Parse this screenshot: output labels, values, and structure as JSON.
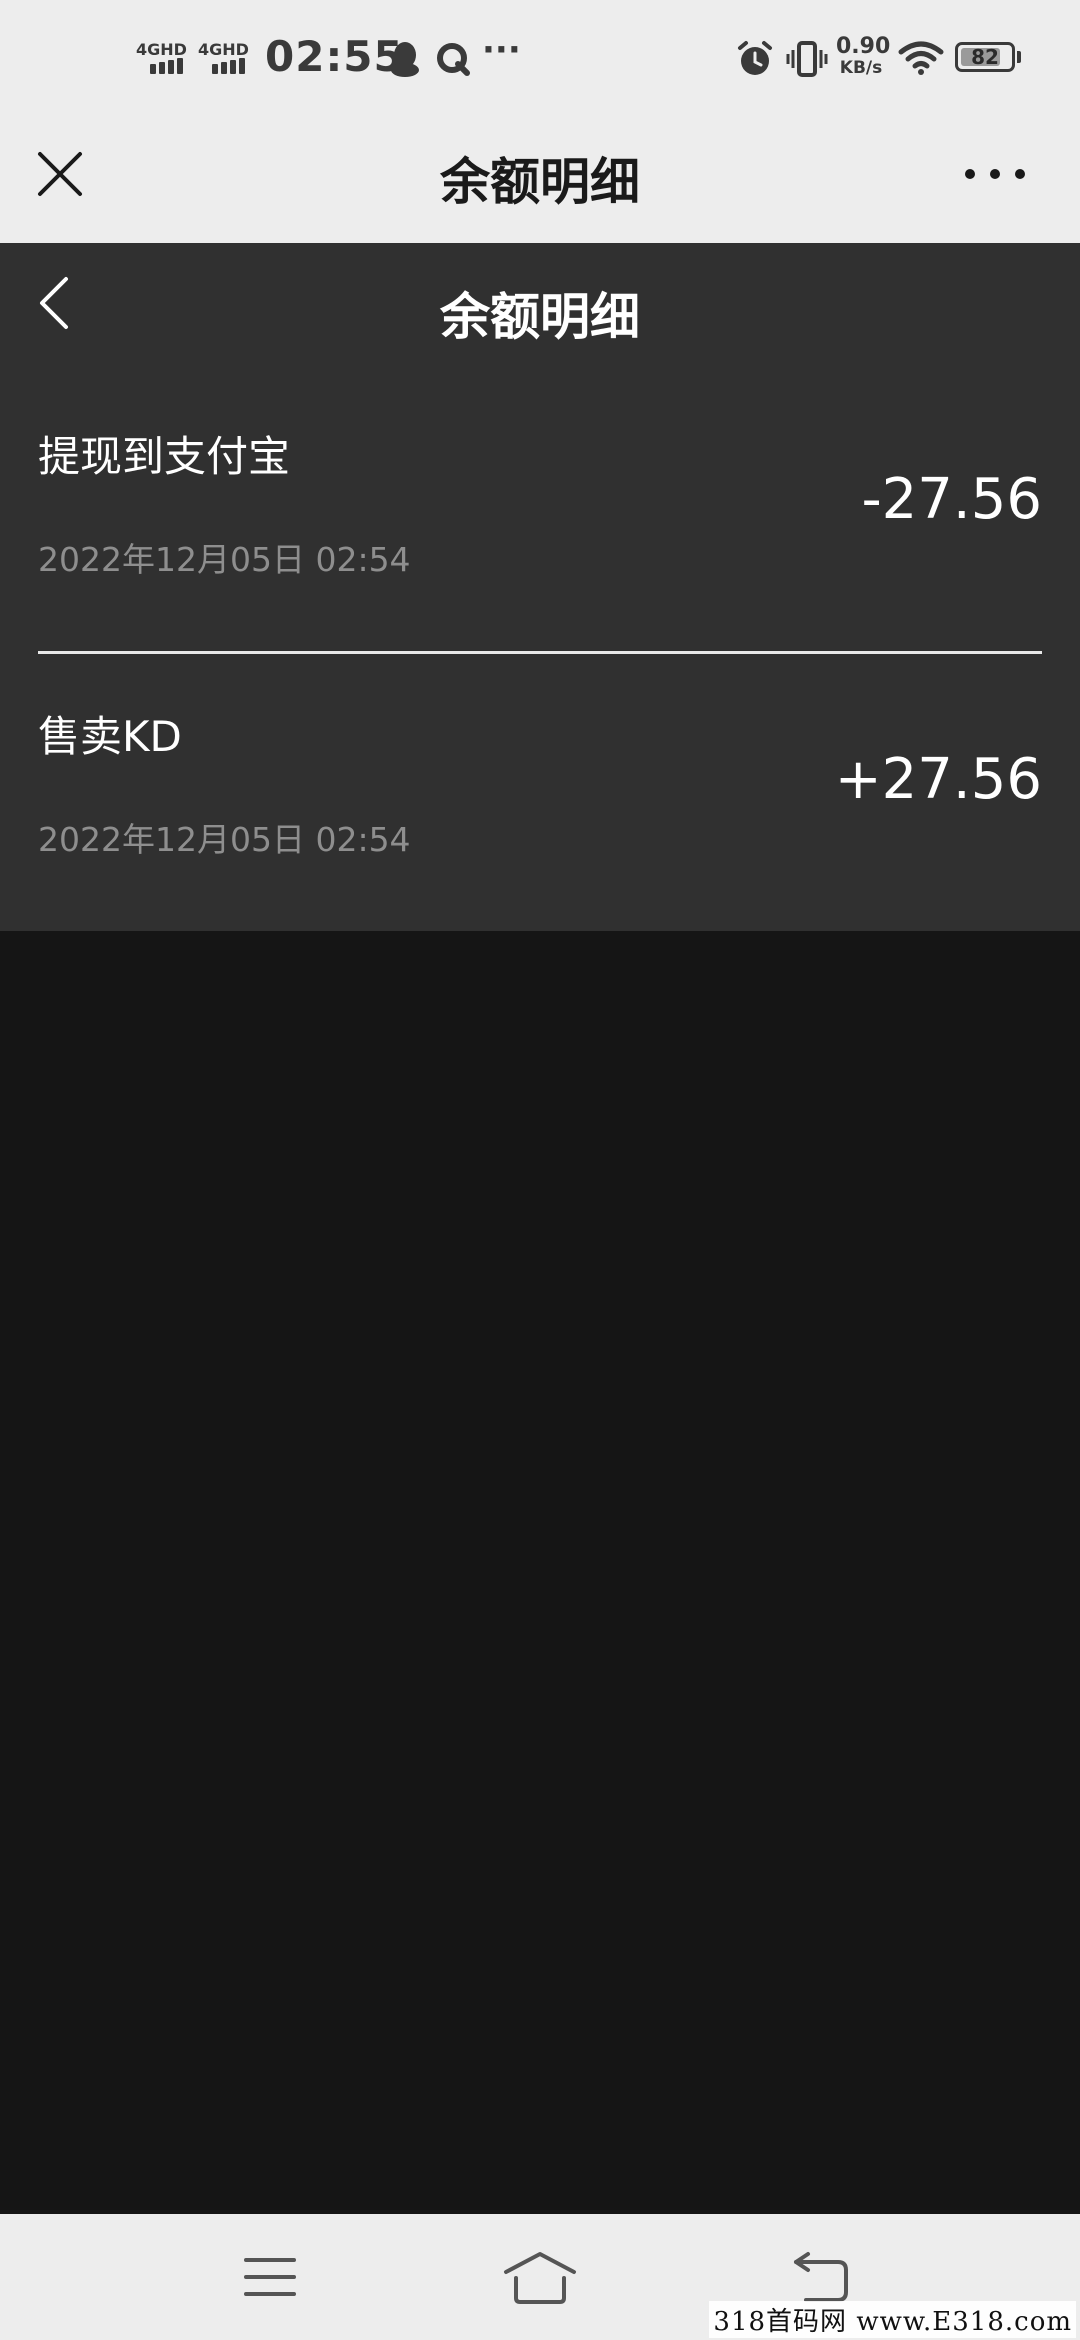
{
  "status_bar": {
    "network_1": "4GHD",
    "network_2": "4GHD",
    "time": "02:55",
    "more_label": "···",
    "speed_value": "0.90",
    "speed_unit": "KB/s",
    "battery_level": "82",
    "battery_fraction": 0.82
  },
  "app_header": {
    "title": "余额明细"
  },
  "page": {
    "title": "余额明细"
  },
  "transactions": [
    {
      "title": "提现到支付宝",
      "date": "2022年12月05日 02:54",
      "amount": "-27.56"
    },
    {
      "title": "售卖KD",
      "date": "2022年12月05日 02:54",
      "amount": "+27.56"
    }
  ],
  "watermark": "318首码网 www.E318.com",
  "colors": {
    "status_bg": "#ededed",
    "panel_bg": "#303030",
    "page_bg": "#151515",
    "text_primary": "#ffffff",
    "text_secondary": "#8e8e8e"
  }
}
